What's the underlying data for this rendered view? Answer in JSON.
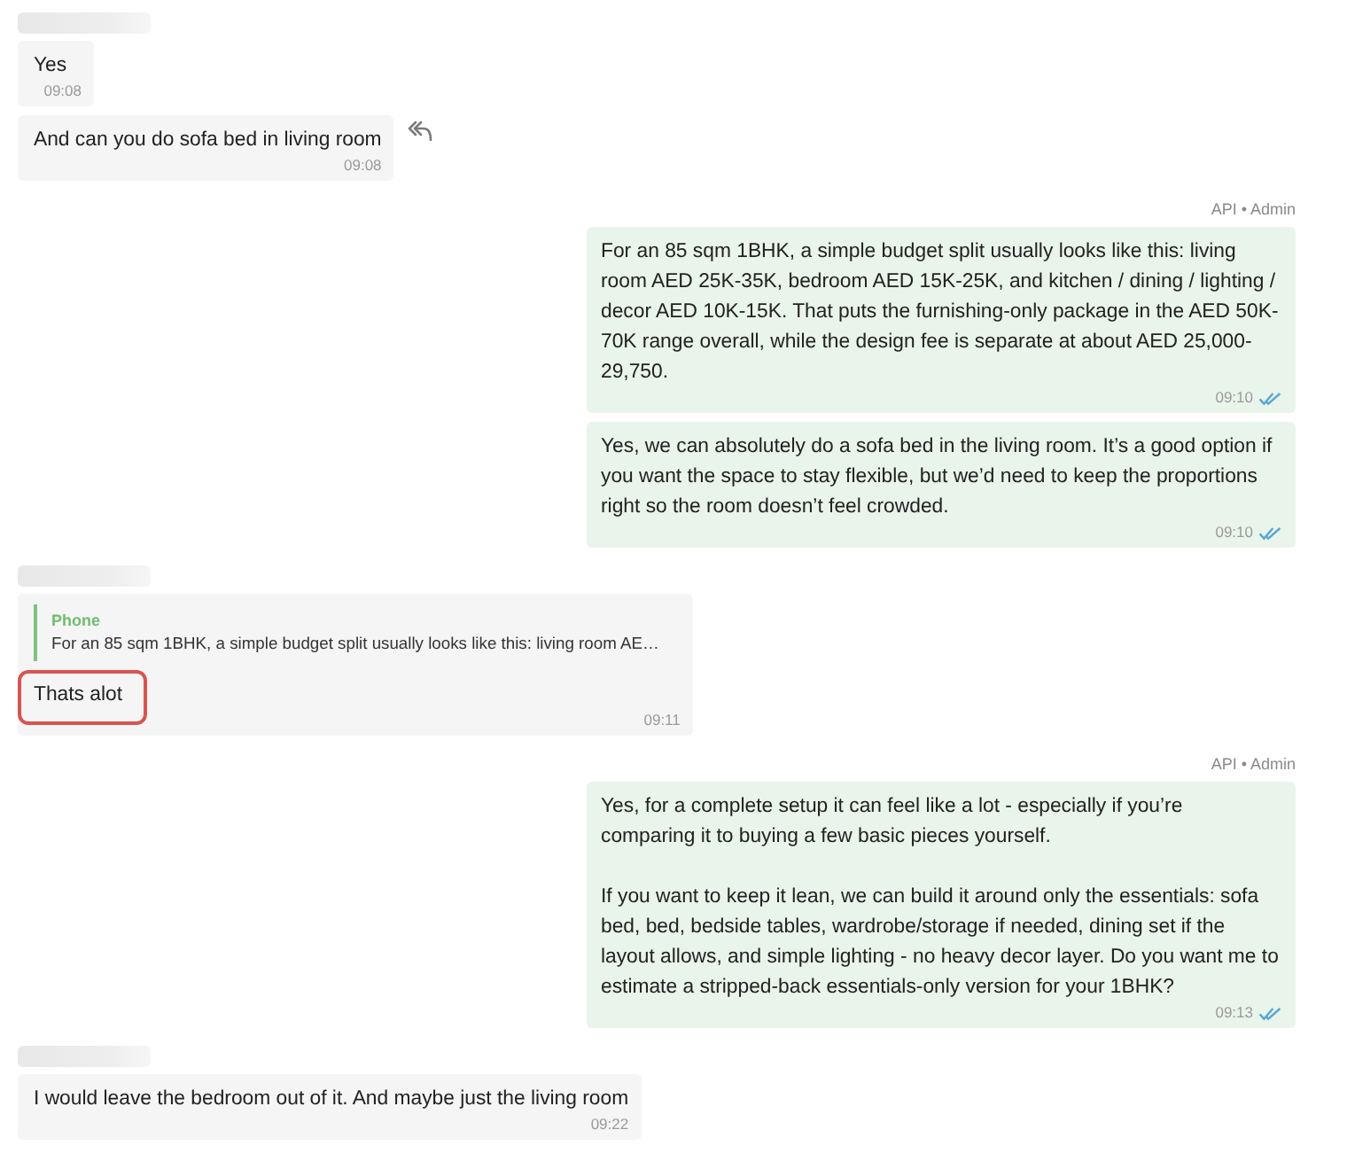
{
  "groups": [
    {
      "kind": "incoming",
      "sender_redacted": true,
      "messages": [
        {
          "text": "Yes",
          "time": "09:08",
          "highlighted": false,
          "reply_action": false
        },
        {
          "text": "And can you do sofa bed in living room",
          "time": "09:08",
          "highlighted": false,
          "reply_action": true
        }
      ]
    },
    {
      "kind": "outgoing",
      "sender": "API • Admin",
      "messages": [
        {
          "text": "For an 85 sqm 1BHK, a simple budget split usually looks like this: living room AED 25K-35K, bedroom AED 15K-25K, and kitchen / dining / lighting / decor AED 10K-15K. That puts the furnishing-only package in the AED 50K-70K range overall, while the design fee is separate at about AED 25,000-29,750.",
          "time": "09:10",
          "read": true,
          "highlighted": false
        },
        {
          "text": "Yes, we can absolutely do a sofa bed in the living room. It’s a good option if you want the space to stay flexible, but we’d need to keep the proportions right so the room doesn’t feel crowded.",
          "time": "09:10",
          "read": true,
          "highlighted": false
        }
      ]
    },
    {
      "kind": "incoming",
      "sender_redacted": true,
      "messages": [
        {
          "quote": {
            "author": "Phone",
            "text": "For an 85 sqm 1BHK, a simple budget split usually looks like this: living room AE…"
          },
          "text": "Thats alot",
          "time": "09:11",
          "highlighted": true,
          "reply_action": false
        }
      ]
    },
    {
      "kind": "outgoing",
      "sender": "API • Admin",
      "messages": [
        {
          "text": "Yes, for a complete setup it can feel like a lot - especially if you’re comparing it to buying a few basic pieces yourself.\n\nIf you want to keep it lean, we can build it around only the essentials: sofa bed, bed, bedside tables, wardrobe/storage if needed, dining set if the layout allows, and simple lighting - no heavy decor layer. Do you want me to estimate a stripped-back essentials-only version for your 1BHK?",
          "time": "09:13",
          "read": true,
          "highlighted": false
        }
      ]
    },
    {
      "kind": "incoming",
      "sender_redacted": true,
      "messages": [
        {
          "text": "I would leave the bedroom out of it. And maybe just the living room",
          "time": "09:22",
          "highlighted": false,
          "reply_action": false
        }
      ]
    }
  ]
}
